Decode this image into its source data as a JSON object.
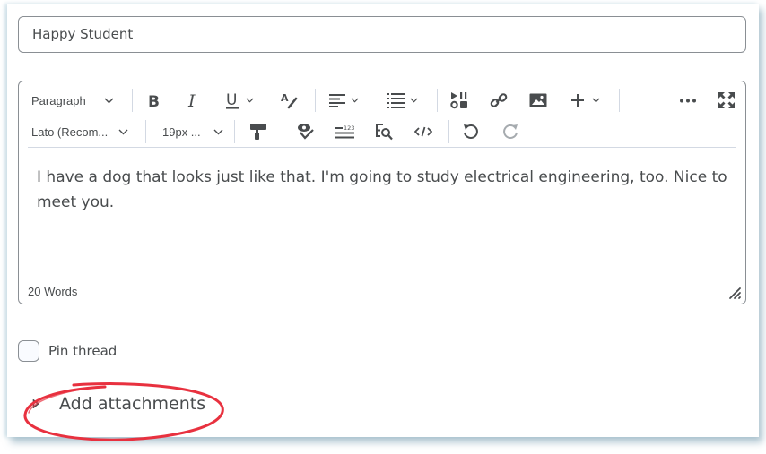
{
  "title_field": {
    "value": "Happy Student"
  },
  "toolbar": {
    "block_format": "Paragraph",
    "font_family": "Lato (Recom...",
    "font_size": "19px ...",
    "icons_row1": [
      "bold-icon",
      "italic-icon",
      "underline-icon",
      "strikethrough-format-icon",
      "align-left-icon",
      "bulleted-list-icon",
      "media-icon",
      "link-icon",
      "image-icon",
      "insert-plus-icon",
      "more-options-icon",
      "fullscreen-icon"
    ],
    "icons_row2": [
      "format-painter-icon",
      "spell-check-icon",
      "word-count-icon",
      "find-replace-icon",
      "source-code-icon",
      "undo-icon",
      "redo-icon"
    ]
  },
  "editor": {
    "content": "I have a dog that looks just like that. I'm going to study electrical engineering, too. Nice to meet you.",
    "word_count": "20 Words"
  },
  "pin_thread": {
    "label": "Pin thread",
    "checked": false
  },
  "attachments": {
    "label": "Add attachments",
    "expanded": false
  },
  "annotation": {
    "color": "#e8313f"
  }
}
